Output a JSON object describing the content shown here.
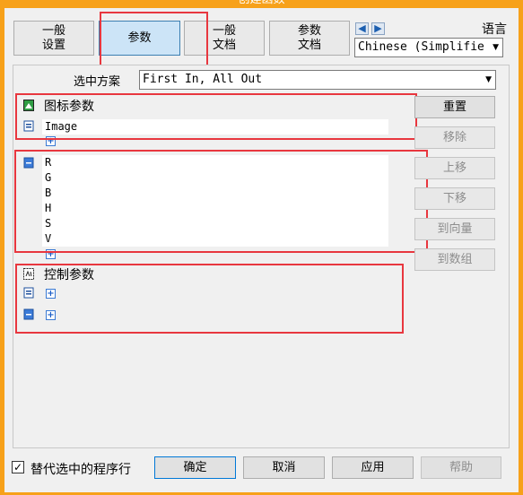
{
  "window": {
    "title": "创建函数"
  },
  "tabs": [
    {
      "line1": "一般",
      "line2": "设置"
    },
    {
      "line1": "参数",
      "line2": ""
    },
    {
      "line1": "一般",
      "line2": "文档"
    },
    {
      "line1": "参数",
      "line2": "文档"
    }
  ],
  "language": {
    "label": "语言",
    "selected": "Chinese (Simplifie"
  },
  "scheme": {
    "label": "选中方案",
    "selected": "First In, All Out"
  },
  "icon_params": {
    "label": "图标参数",
    "items": [
      "Image"
    ]
  },
  "params_list": {
    "items": [
      "R",
      "G",
      "B",
      "H",
      "S",
      "V"
    ]
  },
  "control_params": {
    "label": "控制参数"
  },
  "side_buttons": {
    "reset": "重置",
    "remove": "移除",
    "move_up": "上移",
    "move_down": "下移",
    "to_vector": "到向量",
    "to_array": "到数组"
  },
  "footer": {
    "checkbox_label": "替代选中的程序行",
    "checkbox_checked": true,
    "ok": "确定",
    "cancel": "取消",
    "apply": "应用",
    "help": "帮助"
  },
  "colors": {
    "frame": "#f7a11a",
    "highlight": "#e8373f",
    "active_tab": "#cce4f7"
  }
}
